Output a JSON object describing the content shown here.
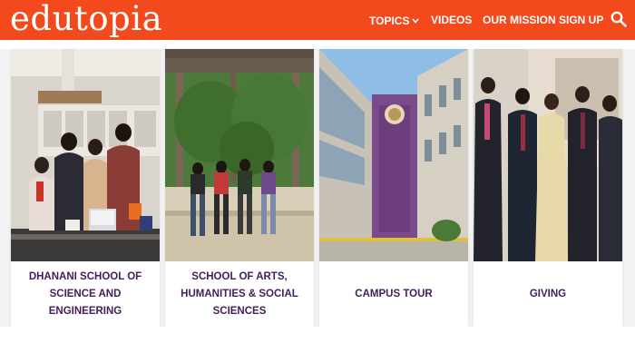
{
  "header": {
    "logo": "edutopia",
    "nav": [
      {
        "label": "TOPICS",
        "has_dropdown": true
      },
      {
        "label": "VIDEOS",
        "has_dropdown": false
      },
      {
        "label": "OUR MISSION",
        "has_dropdown": false
      },
      {
        "label": "SIGN UP",
        "has_dropdown": false
      }
    ],
    "search_icon": "search-icon",
    "chevron_icon": "chevron-down-icon"
  },
  "cards": [
    {
      "label": "DHANANI SCHOOL OF SCIENCE AND ENGINEERING",
      "image": "students-in-science-lab-photo"
    },
    {
      "label": "SCHOOL OF ARTS, HUMANITIES & SOCIAL SCIENCES",
      "image": "students-sitting-outdoors-photo"
    },
    {
      "label": "CAMPUS TOUR",
      "image": "campus-building-photo"
    },
    {
      "label": "GIVING",
      "image": "donors-group-photo"
    }
  ],
  "colors": {
    "header_bg": "#f24a1c",
    "header_text": "#ffffff",
    "card_label": "#43205c",
    "page_bg": "#ffffff"
  }
}
